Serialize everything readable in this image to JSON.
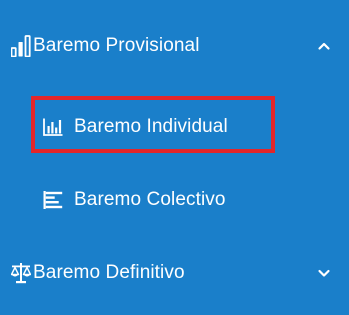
{
  "sidebar": {
    "items": [
      {
        "label": "Baremo Provisional",
        "icon": "bar-chart-icon",
        "expanded": true,
        "chevron": "chevron-up-icon"
      },
      {
        "label": "Baremo Individual",
        "icon": "column-chart-icon",
        "selected": true
      },
      {
        "label": "Baremo Colectivo",
        "icon": "list-align-left-icon"
      },
      {
        "label": "Baremo Definitivo",
        "icon": "scale-balance-icon",
        "expanded": false,
        "chevron": "chevron-down-icon"
      }
    ]
  },
  "colors": {
    "background": "#1a7fca",
    "text": "#ffffff",
    "highlight": "#e3262a"
  }
}
